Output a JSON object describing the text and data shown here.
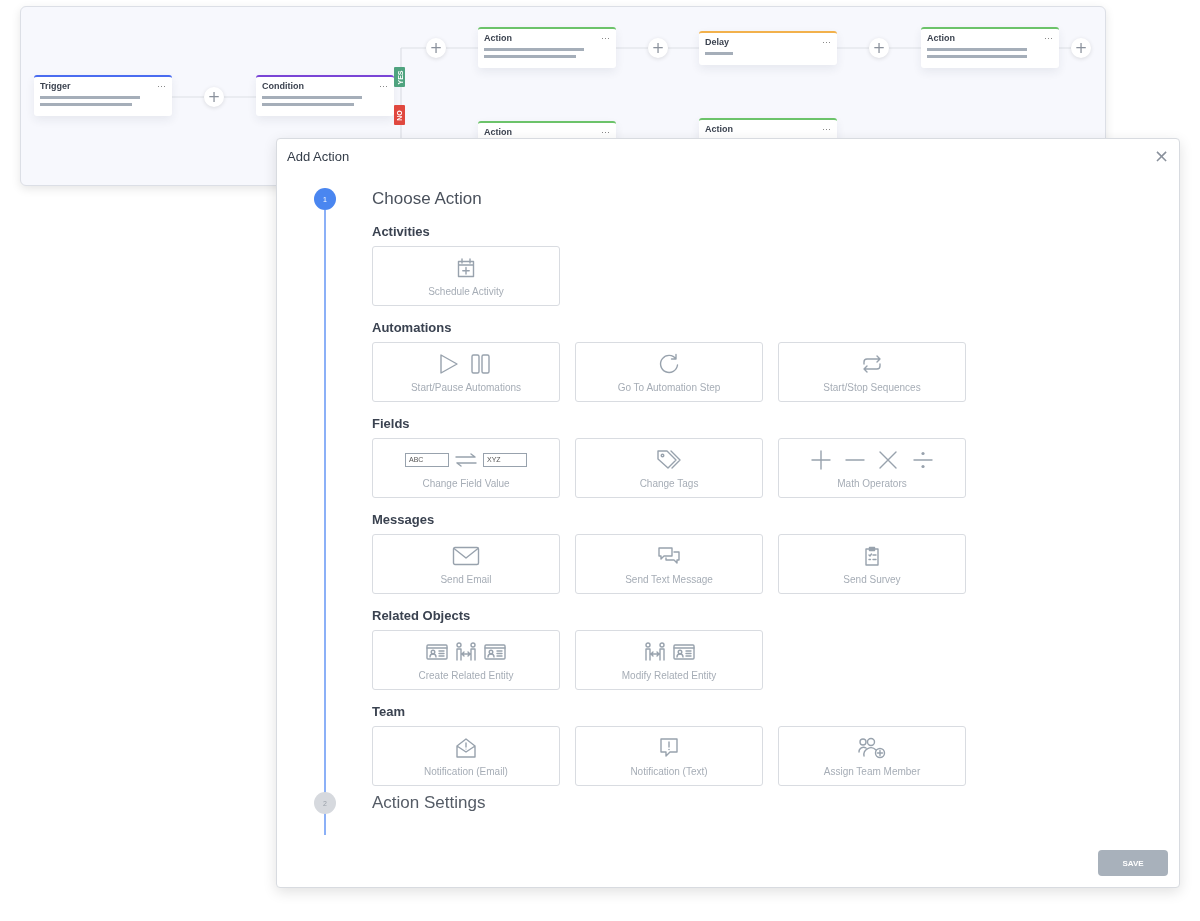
{
  "canvas": {
    "nodes": [
      {
        "title": "Trigger",
        "color": "#4a6cf0",
        "menu": "···",
        "lines": [
          {
            "kind": "long"
          },
          {
            "kind": "medium"
          }
        ]
      },
      {
        "title": "Condition",
        "color": "#7a45d6",
        "menu": "···",
        "lines": [
          {
            "kind": "long"
          },
          {
            "kind": "medium"
          }
        ]
      },
      {
        "title": "Action",
        "color": "#6cc36a",
        "menu": "···",
        "lines": [
          {
            "kind": "long"
          },
          {
            "kind": "medium"
          }
        ]
      },
      {
        "title": "Delay",
        "color": "#f2b14c",
        "menu": "···",
        "lines": [
          {
            "kind": "short"
          }
        ]
      },
      {
        "title": "Action",
        "color": "#6cc36a",
        "menu": "···",
        "lines": [
          {
            "kind": "long"
          },
          {
            "kind": "long"
          }
        ]
      },
      {
        "title": "Action",
        "color": "#6cc36a",
        "menu": "···"
      },
      {
        "title": "Action",
        "color": "#6cc36a",
        "menu": "···"
      }
    ],
    "branches": [
      {
        "label": "YES",
        "color": "#4fa37f"
      },
      {
        "label": "NO",
        "color": "#e0483f"
      }
    ],
    "add_buttons": [
      "+",
      "+",
      "+",
      "+",
      "+"
    ]
  },
  "dialog": {
    "title": "Add Action",
    "close": "×",
    "steps": [
      {
        "number": "1",
        "title": "Choose Action",
        "selected": true
      },
      {
        "number": "2",
        "title": "Action Settings",
        "selected": false
      }
    ],
    "sections": [
      {
        "heading": "Activities",
        "tiles": [
          {
            "label": "Schedule Activity"
          }
        ]
      },
      {
        "heading": "Automations",
        "tiles": [
          {
            "label": "Start/Pause Automations"
          },
          {
            "label": "Go To Automation Step"
          },
          {
            "label": "Start/Stop Sequences"
          }
        ]
      },
      {
        "heading": "Fields",
        "tiles": [
          {
            "label": "Change Field Value",
            "from": "ABC",
            "to": "XYZ"
          },
          {
            "label": "Change Tags"
          },
          {
            "label": "Math Operators"
          }
        ]
      },
      {
        "heading": "Messages",
        "tiles": [
          {
            "label": "Send Email"
          },
          {
            "label": "Send Text Message"
          },
          {
            "label": "Send Survey"
          }
        ]
      },
      {
        "heading": "Related Objects",
        "tiles": [
          {
            "label": "Create Related Entity"
          },
          {
            "label": "Modify Related Entity"
          }
        ]
      },
      {
        "heading": "Team",
        "tiles": [
          {
            "label": "Notification (Email)"
          },
          {
            "label": "Notification (Text)"
          },
          {
            "label": "Assign Team Member"
          }
        ]
      }
    ],
    "save": {
      "label": "SAVE",
      "disabled": true
    }
  }
}
